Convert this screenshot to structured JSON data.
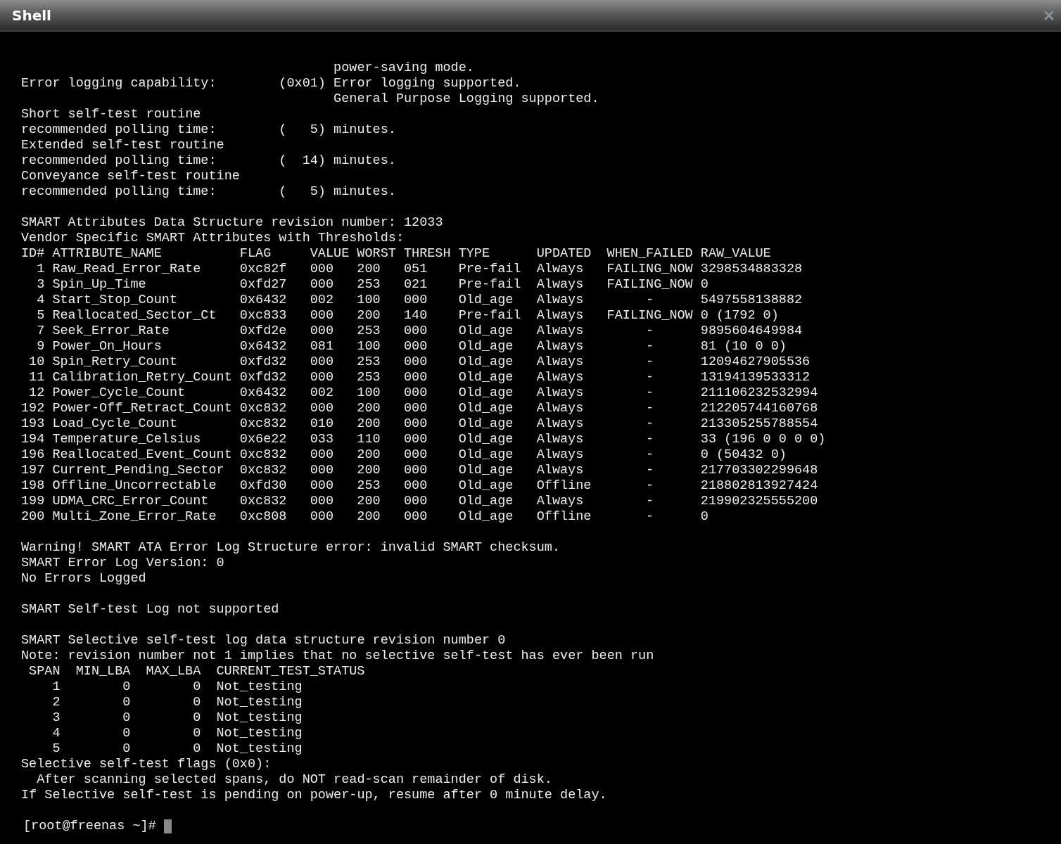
{
  "window": {
    "title": "Shell"
  },
  "terminal": {
    "sections": [
      [
        {
          "kind": "text",
          "lines": [
            "                                        power-saving mode.",
            "Error logging capability:        (0x01) Error logging supported.",
            "                                        General Purpose Logging supported.",
            "Short self-test routine",
            "recommended polling time:        (   5) minutes.",
            "Extended self-test routine",
            "recommended polling time:        (  14) minutes.",
            "Conveyance self-test routine",
            "recommended polling time:        (   5) minutes."
          ]
        }
      ],
      [
        {
          "kind": "text",
          "lines": [
            "SMART Attributes Data Structure revision number: 12033",
            "Vendor Specific SMART Attributes with Thresholds:"
          ]
        },
        {
          "kind": "attributes",
          "columns": [
            "ID#",
            "ATTRIBUTE_NAME",
            "FLAG",
            "VALUE",
            "WORST",
            "THRESH",
            "TYPE",
            "UPDATED",
            "WHEN_FAILED",
            "RAW_VALUE"
          ],
          "rows": [
            [
              "1",
              "Raw_Read_Error_Rate",
              "0xc82f",
              "000",
              "200",
              "051",
              "Pre-fail",
              "Always",
              "FAILING_NOW",
              "3298534883328"
            ],
            [
              "3",
              "Spin_Up_Time",
              "0xfd27",
              "000",
              "253",
              "021",
              "Pre-fail",
              "Always",
              "FAILING_NOW",
              "0"
            ],
            [
              "4",
              "Start_Stop_Count",
              "0x6432",
              "002",
              "100",
              "000",
              "Old_age",
              "Always",
              "-",
              "5497558138882"
            ],
            [
              "5",
              "Reallocated_Sector_Ct",
              "0xc833",
              "000",
              "200",
              "140",
              "Pre-fail",
              "Always",
              "FAILING_NOW",
              "0 (1792 0)"
            ],
            [
              "7",
              "Seek_Error_Rate",
              "0xfd2e",
              "000",
              "253",
              "000",
              "Old_age",
              "Always",
              "-",
              "9895604649984"
            ],
            [
              "9",
              "Power_On_Hours",
              "0x6432",
              "081",
              "100",
              "000",
              "Old_age",
              "Always",
              "-",
              "81 (10 0 0)"
            ],
            [
              "10",
              "Spin_Retry_Count",
              "0xfd32",
              "000",
              "253",
              "000",
              "Old_age",
              "Always",
              "-",
              "12094627905536"
            ],
            [
              "11",
              "Calibration_Retry_Count",
              "0xfd32",
              "000",
              "253",
              "000",
              "Old_age",
              "Always",
              "-",
              "13194139533312"
            ],
            [
              "12",
              "Power_Cycle_Count",
              "0x6432",
              "002",
              "100",
              "000",
              "Old_age",
              "Always",
              "-",
              "211106232532994"
            ],
            [
              "192",
              "Power-Off_Retract_Count",
              "0xc832",
              "000",
              "200",
              "000",
              "Old_age",
              "Always",
              "-",
              "212205744160768"
            ],
            [
              "193",
              "Load_Cycle_Count",
              "0xc832",
              "010",
              "200",
              "000",
              "Old_age",
              "Always",
              "-",
              "213305255788554"
            ],
            [
              "194",
              "Temperature_Celsius",
              "0x6e22",
              "033",
              "110",
              "000",
              "Old_age",
              "Always",
              "-",
              "33 (196 0 0 0 0)"
            ],
            [
              "196",
              "Reallocated_Event_Count",
              "0xc832",
              "000",
              "200",
              "000",
              "Old_age",
              "Always",
              "-",
              "0 (50432 0)"
            ],
            [
              "197",
              "Current_Pending_Sector",
              "0xc832",
              "000",
              "200",
              "000",
              "Old_age",
              "Always",
              "-",
              "217703302299648"
            ],
            [
              "198",
              "Offline_Uncorrectable",
              "0xfd30",
              "000",
              "253",
              "000",
              "Old_age",
              "Offline",
              "-",
              "218802813927424"
            ],
            [
              "199",
              "UDMA_CRC_Error_Count",
              "0xc832",
              "000",
              "200",
              "000",
              "Old_age",
              "Always",
              "-",
              "219902325555200"
            ],
            [
              "200",
              "Multi_Zone_Error_Rate",
              "0xc808",
              "000",
              "200",
              "000",
              "Old_age",
              "Offline",
              "-",
              "0"
            ]
          ]
        }
      ],
      [
        {
          "kind": "text",
          "lines": [
            "Warning! SMART ATA Error Log Structure error: invalid SMART checksum.",
            "SMART Error Log Version: 0",
            "No Errors Logged"
          ]
        }
      ],
      [
        {
          "kind": "text",
          "lines": [
            "SMART Self-test Log not supported"
          ]
        }
      ],
      [
        {
          "kind": "text",
          "lines": [
            "SMART Selective self-test log data structure revision number 0",
            "Note: revision number not 1 implies that no selective self-test has ever been run"
          ]
        },
        {
          "kind": "spans",
          "columns": [
            "SPAN",
            "MIN_LBA",
            "MAX_LBA",
            "CURRENT_TEST_STATUS"
          ],
          "rows": [
            [
              "1",
              "0",
              "0",
              "Not_testing"
            ],
            [
              "2",
              "0",
              "0",
              "Not_testing"
            ],
            [
              "3",
              "0",
              "0",
              "Not_testing"
            ],
            [
              "4",
              "0",
              "0",
              "Not_testing"
            ],
            [
              "5",
              "0",
              "0",
              "Not_testing"
            ]
          ]
        },
        {
          "kind": "text",
          "lines": [
            "Selective self-test flags (0x0):",
            "  After scanning selected spans, do NOT read-scan remainder of disk.",
            "If Selective self-test is pending on power-up, resume after 0 minute delay."
          ]
        }
      ]
    ],
    "prompt": "[root@freenas ~]#"
  }
}
